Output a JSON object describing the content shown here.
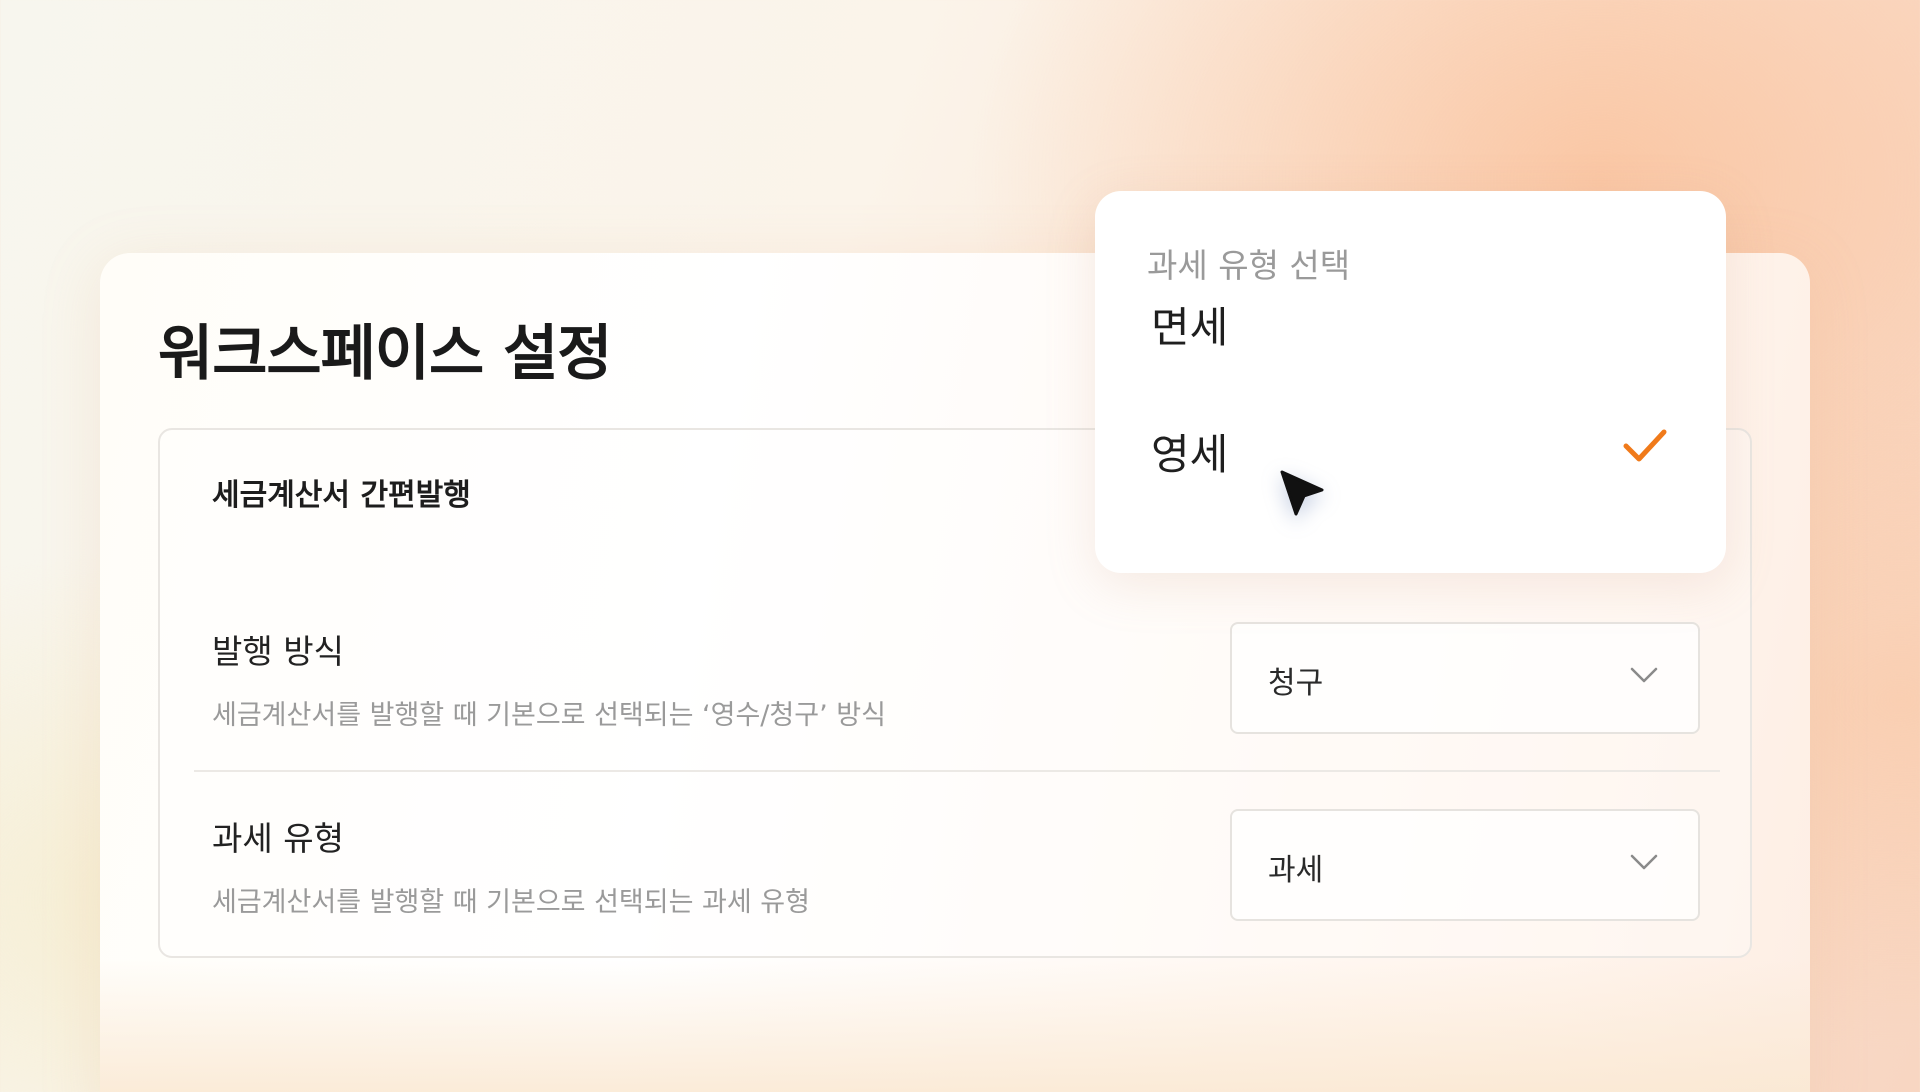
{
  "page": {
    "title": "워크스페이스 설정"
  },
  "section": {
    "title": "세금계산서 간편발행",
    "rows": [
      {
        "label": "발행 방식",
        "description": "세금계산서를 발행할 때 기본으로 선택되는 ‘영수/청구’ 방식",
        "value": "청구",
        "icon": "chevron-down-icon"
      },
      {
        "label": "과세 유형",
        "description": "세금계산서를 발행할 때 기본으로 선택되는 과세 유형",
        "value": "과세",
        "icon": "chevron-down-icon"
      }
    ]
  },
  "dropdown": {
    "header": "과세 유형 선택",
    "options": [
      {
        "label": "면세",
        "selected": false
      },
      {
        "label": "영세",
        "selected": true
      }
    ],
    "check_icon": "check-icon",
    "accent_color": "#f07a1a"
  },
  "cursor": {
    "icon": "mouse-pointer-icon"
  }
}
